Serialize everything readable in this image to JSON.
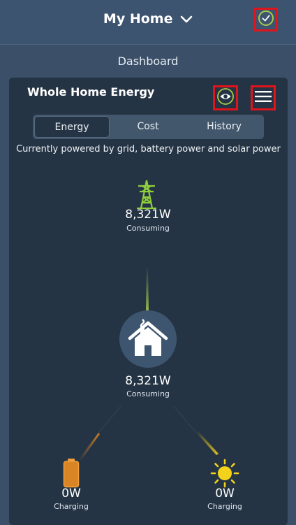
{
  "header": {
    "title": "My Home",
    "status_icon": "check-circle-icon",
    "accent_color": "#a6c94a"
  },
  "page": {
    "subtitle": "Dashboard"
  },
  "card": {
    "title": "Whole Home Energy",
    "tabs": [
      {
        "label": "Energy",
        "active": true
      },
      {
        "label": "Cost",
        "active": false
      },
      {
        "label": "History",
        "active": false
      }
    ],
    "status_text": "Currently powered by grid, battery power and solar power"
  },
  "nodes": {
    "grid": {
      "value": "8,321W",
      "label": "Consuming",
      "icon": "power-tower-icon"
    },
    "home": {
      "value": "8,321W",
      "label": "Consuming",
      "icon": "house-icon"
    },
    "battery": {
      "value": "0W",
      "label": "Charging",
      "icon": "battery-icon",
      "color": "#d98526"
    },
    "solar": {
      "value": "0W",
      "label": "Charging",
      "icon": "sun-icon",
      "color": "#f3d21c"
    }
  }
}
